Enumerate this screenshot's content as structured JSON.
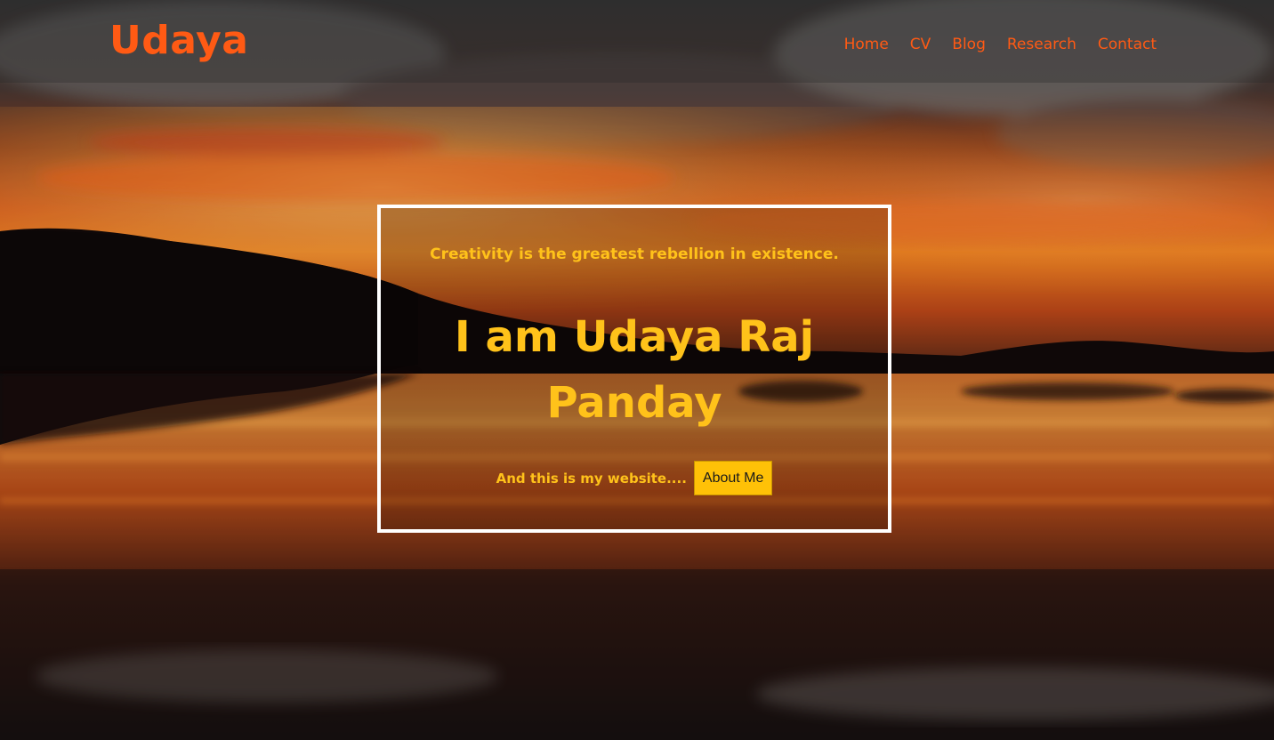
{
  "header": {
    "logo": "Udaya",
    "nav": [
      {
        "label": "Home"
      },
      {
        "label": "CV"
      },
      {
        "label": "Blog"
      },
      {
        "label": "Research"
      },
      {
        "label": "Contact"
      }
    ]
  },
  "hero": {
    "tagline": "Creativity is the greatest rebellion in existence.",
    "headline": "I am Udaya Raj Panday",
    "subtext": "And this is my website....",
    "button_label": "About Me"
  },
  "colors": {
    "accent": "#ff5a14",
    "hero_text": "#ffc21a",
    "button_bg": "#ffc107",
    "box_border": "#ffffff"
  },
  "background": {
    "description_icon": "sunset-lake-photo"
  }
}
